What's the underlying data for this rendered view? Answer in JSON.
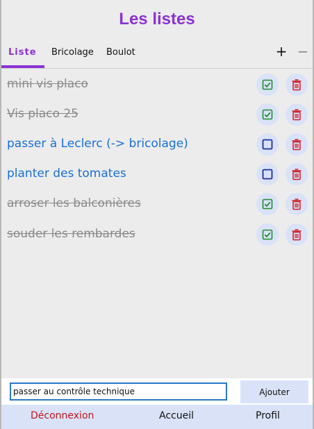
{
  "header": {
    "title": "Les listes"
  },
  "tabs": [
    {
      "label": "Liste"
    },
    {
      "label": "Bricolage"
    },
    {
      "label": "Boulot"
    }
  ],
  "tab_tools": {
    "add": "+",
    "remove": "−"
  },
  "items": [
    {
      "text": "mini vis placo",
      "done": true
    },
    {
      "text": "Vis placo 25",
      "done": true
    },
    {
      "text": "passer à Leclerc (-> bricolage)",
      "done": false
    },
    {
      "text": "planter des tomates",
      "done": false
    },
    {
      "text": "arroser les balconières",
      "done": true
    },
    {
      "text": "souder les rembardes",
      "done": true
    }
  ],
  "new_item": {
    "value": "passer au contrôle technique"
  },
  "add_button": {
    "label": "Ajouter"
  },
  "nav": {
    "logout": "Déconnexion",
    "home": "Accueil",
    "profile": "Profil"
  },
  "colors": {
    "accent": "#8b32d6",
    "todo_text": "#1a6fd6",
    "done_text": "#8a8a8a",
    "check_done": "#1e8c2e",
    "check_todo": "#1a2fa0",
    "trash": "#d01c24",
    "button_bg": "#d9e2f7"
  }
}
